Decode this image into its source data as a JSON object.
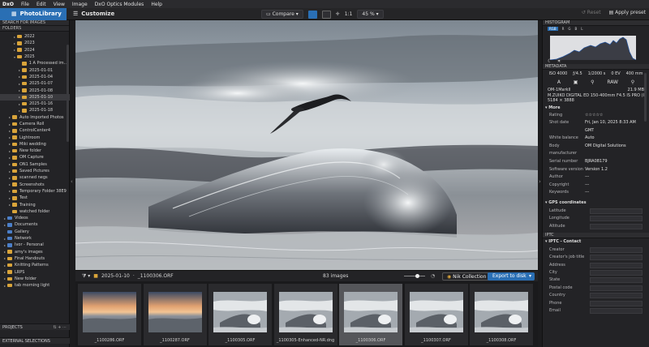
{
  "menubar": {
    "logo": "DxO",
    "items": [
      "File",
      "Edit",
      "View",
      "Image",
      "DxO Optics Modules",
      "Help"
    ]
  },
  "toolbar": {
    "tab_library": "PhotoLibrary",
    "tab_customize": "Customize",
    "compare": "Compare",
    "zoom_fit": "1:1",
    "zoom_level": "45 %",
    "reset": "Reset",
    "apply_preset": "Apply preset"
  },
  "left": {
    "search_header": "SEARCH FOR IMAGES",
    "folders_header": "FOLDERS",
    "tree": [
      {
        "label": "2022",
        "indent": 2,
        "arrow": "▸"
      },
      {
        "label": "2023",
        "indent": 2,
        "arrow": "▸"
      },
      {
        "label": "2024",
        "indent": 2,
        "arrow": "▸"
      },
      {
        "label": "2025",
        "indent": 2,
        "arrow": "▾"
      },
      {
        "label": "1 A Processed image",
        "indent": 3,
        "arrow": ""
      },
      {
        "label": "2025-01-01",
        "indent": 3,
        "arrow": "▸"
      },
      {
        "label": "2025-01-04",
        "indent": 3,
        "arrow": "▸"
      },
      {
        "label": "2025-01-07",
        "indent": 3,
        "arrow": "▸"
      },
      {
        "label": "2025-01-08",
        "indent": 3,
        "arrow": "▸"
      },
      {
        "label": "2025-01-10",
        "indent": 3,
        "arrow": "▸",
        "selected": true
      },
      {
        "label": "2025-01-16",
        "indent": 3,
        "arrow": "▸"
      },
      {
        "label": "2025-01-18",
        "indent": 3,
        "arrow": "▸"
      },
      {
        "label": "Auto Imported Photos",
        "indent": 1,
        "arrow": "▸"
      },
      {
        "label": "Camera Roll",
        "indent": 1,
        "arrow": "▸"
      },
      {
        "label": "ControlCenter4",
        "indent": 1,
        "arrow": "▸"
      },
      {
        "label": "Lightroom",
        "indent": 1,
        "arrow": "▸"
      },
      {
        "label": "Miki wedding",
        "indent": 1,
        "arrow": "▸"
      },
      {
        "label": "New folder",
        "indent": 1,
        "arrow": "▸"
      },
      {
        "label": "OM Capture",
        "indent": 1,
        "arrow": "▸"
      },
      {
        "label": "ON1 Samples",
        "indent": 1,
        "arrow": "▸"
      },
      {
        "label": "Saved Pictures",
        "indent": 1,
        "arrow": "▸"
      },
      {
        "label": "scanned negs",
        "indent": 1,
        "arrow": "▸"
      },
      {
        "label": "Screenshots",
        "indent": 1,
        "arrow": "▸"
      },
      {
        "label": "Temporary Folder 38E9",
        "indent": 1,
        "arrow": "▸"
      },
      {
        "label": "Test",
        "indent": 1,
        "arrow": "▸"
      },
      {
        "label": "Training",
        "indent": 1,
        "arrow": "▸"
      },
      {
        "label": "watched folder",
        "indent": 1,
        "arrow": ""
      },
      {
        "label": "Videos",
        "indent": 0,
        "arrow": "▸",
        "blue": true
      },
      {
        "label": "Documents",
        "indent": 0,
        "arrow": "▸",
        "blue": true
      },
      {
        "label": "Gallery",
        "indent": 0,
        "arrow": "",
        "blue": true
      },
      {
        "label": "Network",
        "indent": 0,
        "arrow": "▸",
        "blue": true
      },
      {
        "label": "Ivor - Personal",
        "indent": 0,
        "arrow": "▸",
        "blue": true
      },
      {
        "label": "amy's images",
        "indent": 0,
        "arrow": "▸"
      },
      {
        "label": "Final Handouts",
        "indent": 0,
        "arrow": "▸"
      },
      {
        "label": "Knitting Patterns",
        "indent": 0,
        "arrow": "▸"
      },
      {
        "label": "LRPS",
        "indent": 0,
        "arrow": "▸"
      },
      {
        "label": "New folder",
        "indent": 0,
        "arrow": "▸"
      },
      {
        "label": "tab morning light",
        "indent": 0,
        "arrow": "▸"
      }
    ],
    "projects": "PROJECTS",
    "external": "EXTERNAL SELECTIONS"
  },
  "strip": {
    "path_folder": "2025-01-10",
    "path_file": "_1100306.ORF",
    "count": "83 images",
    "nik": "Nik Collection",
    "export": "Export to disk"
  },
  "thumbs": [
    {
      "label": "_1100286.ORF",
      "kind": "sunset"
    },
    {
      "label": "_1100287.ORF",
      "kind": "sunset"
    },
    {
      "label": "_1100305.ORF",
      "kind": "wave"
    },
    {
      "label": "_1100305-Enhanced-NR.dng",
      "kind": "wave"
    },
    {
      "label": "_1100306.ORF",
      "kind": "wave",
      "selected": true
    },
    {
      "label": "_1100307.ORF",
      "kind": "wave"
    },
    {
      "label": "_1100308.ORF",
      "kind": "wave"
    }
  ],
  "right": {
    "histogram": "HISTOGRAM",
    "channels": [
      "RGB",
      "R",
      "G",
      "B",
      "L"
    ],
    "metadata": "METADATA",
    "exif": [
      "ISO 4000",
      "ƒ/4.5",
      "1/2000 s",
      "0 EV",
      "400 mm"
    ],
    "icons": [
      "A",
      "▣",
      "⚲",
      "RAW",
      "⚲"
    ],
    "camera": "OM-1Markll",
    "lens": "M.ZUIKO DIGITAL ED 150-400mm F4.5 IS PRO (lf...",
    "dims": "5184 × 3888",
    "filesize": "21.9 MB",
    "more": "More",
    "fields": [
      {
        "k": "Rating",
        "v": "☆☆☆☆☆"
      },
      {
        "k": "Shot date",
        "v": "Fri, Jan 10, 2025 8:33 AM"
      },
      {
        "k": "",
        "v": "GMT"
      },
      {
        "k": "White balance",
        "v": "Auto"
      },
      {
        "k": "Body manufacturer",
        "v": "OM Digital Solutions"
      },
      {
        "k": "Serial number",
        "v": "BJRA08179"
      },
      {
        "k": "Software version",
        "v": "Version 1.2"
      },
      {
        "k": "Author",
        "v": "---"
      },
      {
        "k": "Copyright",
        "v": "---"
      },
      {
        "k": "Keywords",
        "v": "---"
      }
    ],
    "gps": "GPS coordinates",
    "gps_fields": [
      "Latitude",
      "Longitude",
      "Altitude"
    ],
    "iptc": "IPTC",
    "iptc_contact": "IPTC - Contact",
    "iptc_fields": [
      "Creator",
      "Creator's job title",
      "Address",
      "City",
      "State",
      "Postal code",
      "Country",
      "Phone",
      "Email"
    ]
  },
  "colors": {
    "accent": "#2a6fb4",
    "folder": "#d9a43a"
  }
}
